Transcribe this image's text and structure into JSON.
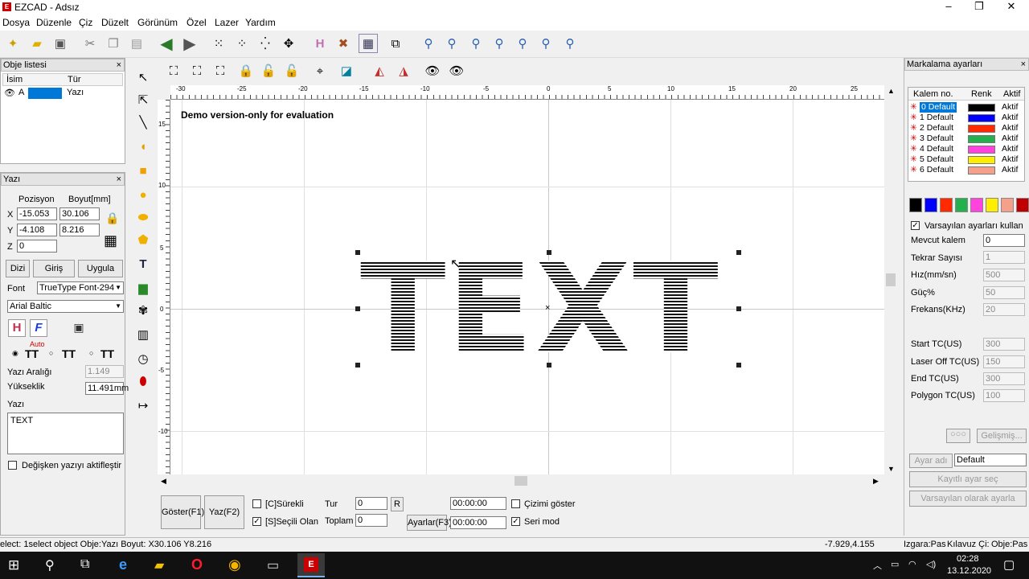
{
  "window": {
    "title": "EZCAD - Adsız"
  },
  "menu": [
    "Dosya",
    "Düzenle",
    "Çiz",
    "Düzelt",
    "Görünüm",
    "Özel",
    "Lazer",
    "Yardım"
  ],
  "object_list": {
    "header": "Obje listesi",
    "col_name": "İsim",
    "col_type": "Tür",
    "rows": [
      {
        "name": "A",
        "type": "Yazı"
      }
    ]
  },
  "text_panel": {
    "header": "Yazı",
    "pos_label": "Pozisyon",
    "size_label": "Boyut[mm]",
    "x_label": "X",
    "y_label": "Y",
    "z_label": "Z",
    "x": "-15.053",
    "y": "-4.108",
    "z": "0",
    "width": "30.106",
    "height": "8.216",
    "btn_array": "Dizi",
    "btn_input": "Giriş portu",
    "btn_apply": "Uygula",
    "font_label": "Font",
    "font_type": "TrueType Font-294",
    "font_name": "Arial Baltic",
    "auto_label": "Auto",
    "char_spacing_label": "Yazı Aralığı",
    "char_spacing": "1.149",
    "height_label": "Yükseklik",
    "height_value": "11.491mm",
    "text_label": "Yazı",
    "text_value": "TEXT",
    "variable_text_label": "Değişken yazıyı aktifleştir"
  },
  "canvas": {
    "demo_notice": "Demo version-only for evaluation",
    "text_object": "TEXT",
    "ruler_top": [
      "-30",
      "-25",
      "-20",
      "-15",
      "-10",
      "-5",
      "0",
      "5",
      "10",
      "15",
      "20",
      "25"
    ],
    "ruler_left": [
      "15",
      "10",
      "5",
      "0",
      "-5",
      "-10"
    ]
  },
  "bottom_controls": {
    "show_btn": "Göster(F1)",
    "mark_btn": "Yaz(F2)",
    "continuous_label": "[C]Sürekli",
    "selected_label": "[S]Seçili Olan",
    "tur_label": "Tur",
    "tur_value": "0",
    "r_btn": "R",
    "total_label": "Toplam",
    "total_value": "0",
    "settings_btn": "Ayarlar(F3)",
    "time1": "00:00:00",
    "time2": "00:00:00",
    "show_drawing_label": "Çizimi göster",
    "serial_mode_label": "Seri mod"
  },
  "right_panel": {
    "header": "Markalama ayarları",
    "col_pen": "Kalem no.",
    "col_color": "Renk",
    "col_active": "Aktif",
    "pens": [
      {
        "name": "0 Default",
        "color": "#000000",
        "active": "Aktif"
      },
      {
        "name": "1 Default",
        "color": "#0000ff",
        "active": "Aktif"
      },
      {
        "name": "2 Default",
        "color": "#ff2a00",
        "active": "Aktif"
      },
      {
        "name": "3 Default",
        "color": "#22b14c",
        "active": "Aktif"
      },
      {
        "name": "4 Default",
        "color": "#ff44dd",
        "active": "Aktif"
      },
      {
        "name": "5 Default",
        "color": "#ffee00",
        "active": "Aktif"
      },
      {
        "name": "6 Default",
        "color": "#f4a08a",
        "active": "Aktif"
      }
    ],
    "swatches": [
      "#000000",
      "#0000ff",
      "#ff2a00",
      "#22b14c",
      "#ff44dd",
      "#ffee00",
      "#f4a08a",
      "#c00000"
    ],
    "use_default_label": "Varsayılan ayarları kullan",
    "params": [
      {
        "label": "Mevcut kalem",
        "value": "0"
      },
      {
        "label": "Tekrar Sayısı",
        "value": "1"
      },
      {
        "label": "Hız(mm/sn)",
        "value": "500"
      },
      {
        "label": "Güç%",
        "value": "50"
      },
      {
        "label": "Frekans(KHz)",
        "value": "20"
      }
    ],
    "timing": [
      {
        "label": "Start TC(US)",
        "value": "300"
      },
      {
        "label": "Laser Off TC(US)",
        "value": "150"
      },
      {
        "label": "End TC(US)",
        "value": "300"
      },
      {
        "label": "Polygon TC(US)",
        "value": "100"
      }
    ],
    "advanced_btn": "Gelişmiş...",
    "param_name_btn": "Ayar adı",
    "param_name_value": "Default",
    "saved_params_btn": "Kayıtlı ayar seç",
    "set_default_btn": "Varsayılan olarak ayarla"
  },
  "status": {
    "message": "elect: 1select object Obje:Yazı Boyut: X30.106 Y8.216",
    "coords": "-7.929,4.155",
    "grid": "Izgara:Pas",
    "guide": "Kılavuz Çi:",
    "object": "Obje:Pas"
  },
  "taskbar": {
    "time": "02:28",
    "date": "13.12.2020"
  }
}
